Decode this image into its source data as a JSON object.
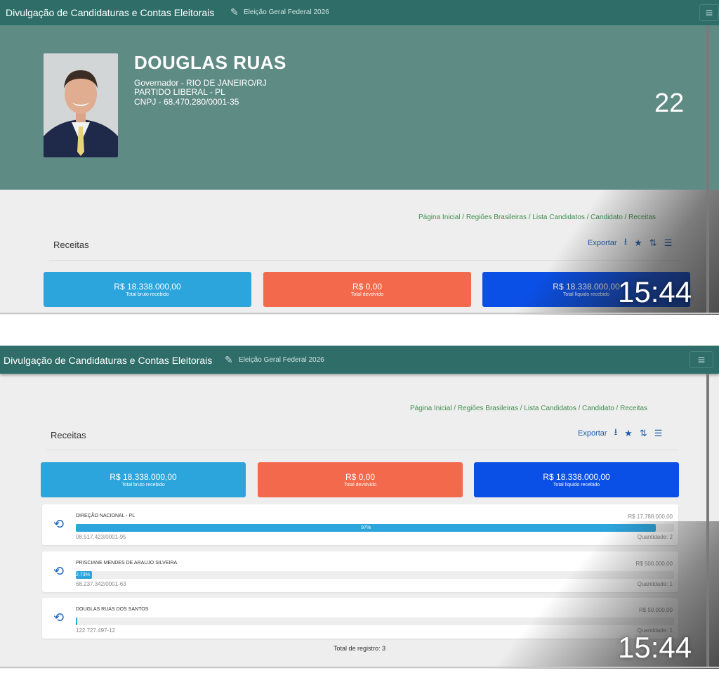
{
  "app": {
    "title": "Divulgação de Candidaturas e Contas Eleitorais",
    "subtitle": "Eleição Geral Federal 2026",
    "edit_icon": "edit-icon",
    "menu_icon": "hamburger-menu-icon"
  },
  "candidate": {
    "name": "DOUGLAS RUAS",
    "office": "Governador - RIO DE JANEIRO/RJ",
    "party": "PARTIDO LIBERAL - PL",
    "cnpj": "CNPJ - 68.470.280/0001-35",
    "number": "22"
  },
  "breadcrumb": {
    "home": "Página Inicial",
    "regions": "Regiões Brasileiras",
    "list": "Lista Candidatos",
    "candidate": "Candidato",
    "current": "Receitas",
    "separator": "/"
  },
  "panel": {
    "title": "Receitas",
    "export_label": "Exportar",
    "icons": [
      "download-icon",
      "star-icon",
      "sort-icon",
      "list-icon"
    ]
  },
  "stats": [
    {
      "value": "R$ 18.338.000,00",
      "label": "Total bruto recebido",
      "color": "#2ca4dc"
    },
    {
      "value": "R$ 0,00",
      "label": "Total devolvido",
      "color": "#f26a4b"
    },
    {
      "value": "R$ 18.338.000,00",
      "label": "Total líquido recebido",
      "color": "#0a4fe6"
    }
  ],
  "receipts": [
    {
      "donor": "DIREÇÃO NACIONAL - PL",
      "amount": "R$ 17.788.000,00",
      "percent_label": "97%",
      "percent": 97,
      "cnpj": "08.517.423/0001-95",
      "quantity": "Quantidade: 2"
    },
    {
      "donor": "PRISCIANE MENDES DE ARAUJO SILVEIRA",
      "amount": "R$ 500.000,00",
      "percent_label": "2.73%",
      "percent": 2.73,
      "cnpj": "68.237.342/0001-63",
      "quantity": "Quantidade: 1"
    },
    {
      "donor": "DOUGLAS RUAS DOS SANTOS",
      "amount": "R$ 50.000,00",
      "percent_label": "",
      "percent": 0.27,
      "cnpj": "122.727.497-12",
      "quantity": "Quantidade: 1"
    }
  ],
  "total_records": "Total de registro: 3",
  "clock": "15:44",
  "colors": {
    "header": "#2f6d68",
    "hero": "#5f8b85",
    "breadcrumb": "#3f8d4f",
    "link": "#1f5fae"
  }
}
